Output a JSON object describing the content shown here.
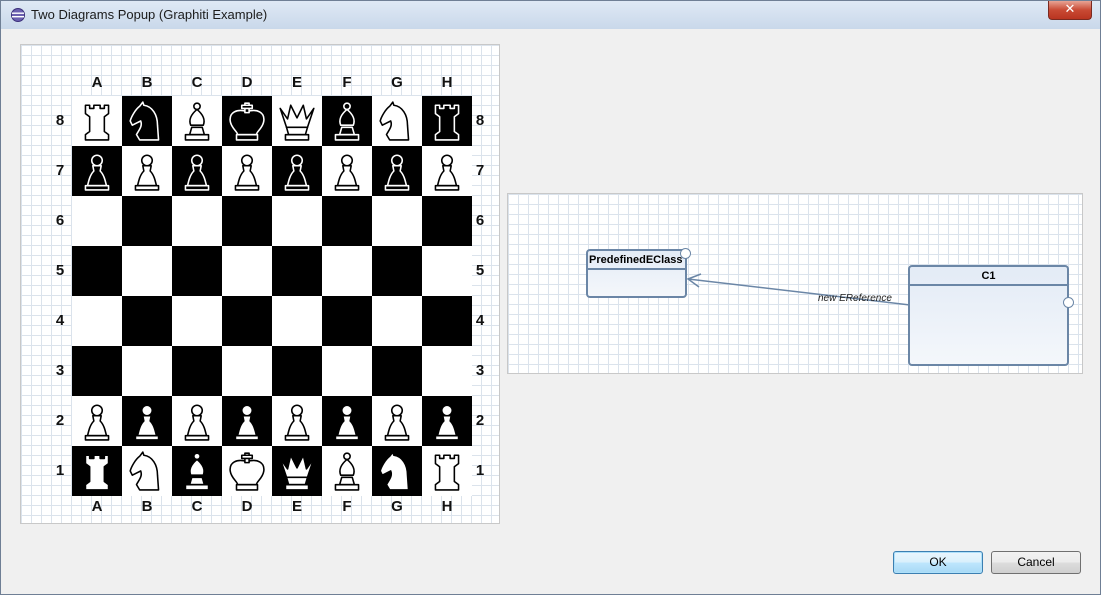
{
  "window": {
    "title": "Two Diagrams Popup (Graphiti Example)",
    "close_label": "✕",
    "icon": "eclipse-icon"
  },
  "chess": {
    "files": [
      "A",
      "B",
      "C",
      "D",
      "E",
      "F",
      "G",
      "H"
    ],
    "ranks": [
      "8",
      "7",
      "6",
      "5",
      "4",
      "3",
      "2",
      "1"
    ],
    "pieces": [
      {
        "square": "a8",
        "type": "rook",
        "color": "white"
      },
      {
        "square": "b8",
        "type": "knight",
        "color": "black"
      },
      {
        "square": "c8",
        "type": "bishop",
        "color": "white"
      },
      {
        "square": "d8",
        "type": "king",
        "color": "black"
      },
      {
        "square": "e8",
        "type": "queen",
        "color": "white"
      },
      {
        "square": "f8",
        "type": "bishop",
        "color": "black"
      },
      {
        "square": "g8",
        "type": "knight",
        "color": "white"
      },
      {
        "square": "h8",
        "type": "rook",
        "color": "black"
      },
      {
        "square": "a7",
        "type": "pawn",
        "color": "black"
      },
      {
        "square": "b7",
        "type": "pawn",
        "color": "white"
      },
      {
        "square": "c7",
        "type": "pawn",
        "color": "black"
      },
      {
        "square": "d7",
        "type": "pawn",
        "color": "white"
      },
      {
        "square": "e7",
        "type": "pawn",
        "color": "black"
      },
      {
        "square": "f7",
        "type": "pawn",
        "color": "white"
      },
      {
        "square": "g7",
        "type": "pawn",
        "color": "black"
      },
      {
        "square": "h7",
        "type": "pawn",
        "color": "white"
      },
      {
        "square": "a2",
        "type": "pawn",
        "color": "white"
      },
      {
        "square": "b2",
        "type": "pawn",
        "color": "white"
      },
      {
        "square": "c2",
        "type": "pawn",
        "color": "white"
      },
      {
        "square": "d2",
        "type": "pawn",
        "color": "white"
      },
      {
        "square": "e2",
        "type": "pawn",
        "color": "white"
      },
      {
        "square": "f2",
        "type": "pawn",
        "color": "white"
      },
      {
        "square": "g2",
        "type": "pawn",
        "color": "white"
      },
      {
        "square": "h2",
        "type": "pawn",
        "color": "white"
      },
      {
        "square": "a1",
        "type": "rook",
        "color": "white"
      },
      {
        "square": "b1",
        "type": "knight",
        "color": "white"
      },
      {
        "square": "c1",
        "type": "bishop",
        "color": "white"
      },
      {
        "square": "d1",
        "type": "king",
        "color": "white"
      },
      {
        "square": "e1",
        "type": "queen",
        "color": "white"
      },
      {
        "square": "f1",
        "type": "bishop",
        "color": "white"
      },
      {
        "square": "g1",
        "type": "knight",
        "color": "white"
      },
      {
        "square": "h1",
        "type": "rook",
        "color": "white"
      }
    ]
  },
  "ecore": {
    "classes": [
      {
        "id": "predefined",
        "name": "PredefinedEClass"
      },
      {
        "id": "c1",
        "name": "C1"
      }
    ],
    "reference": {
      "label": "new EReference",
      "from": "c1",
      "to": "predefined"
    }
  },
  "buttons": {
    "ok": "OK",
    "cancel": "Cancel"
  },
  "colors": {
    "class_border": "#6b86a6",
    "default_button_border": "#3c7fb1"
  }
}
